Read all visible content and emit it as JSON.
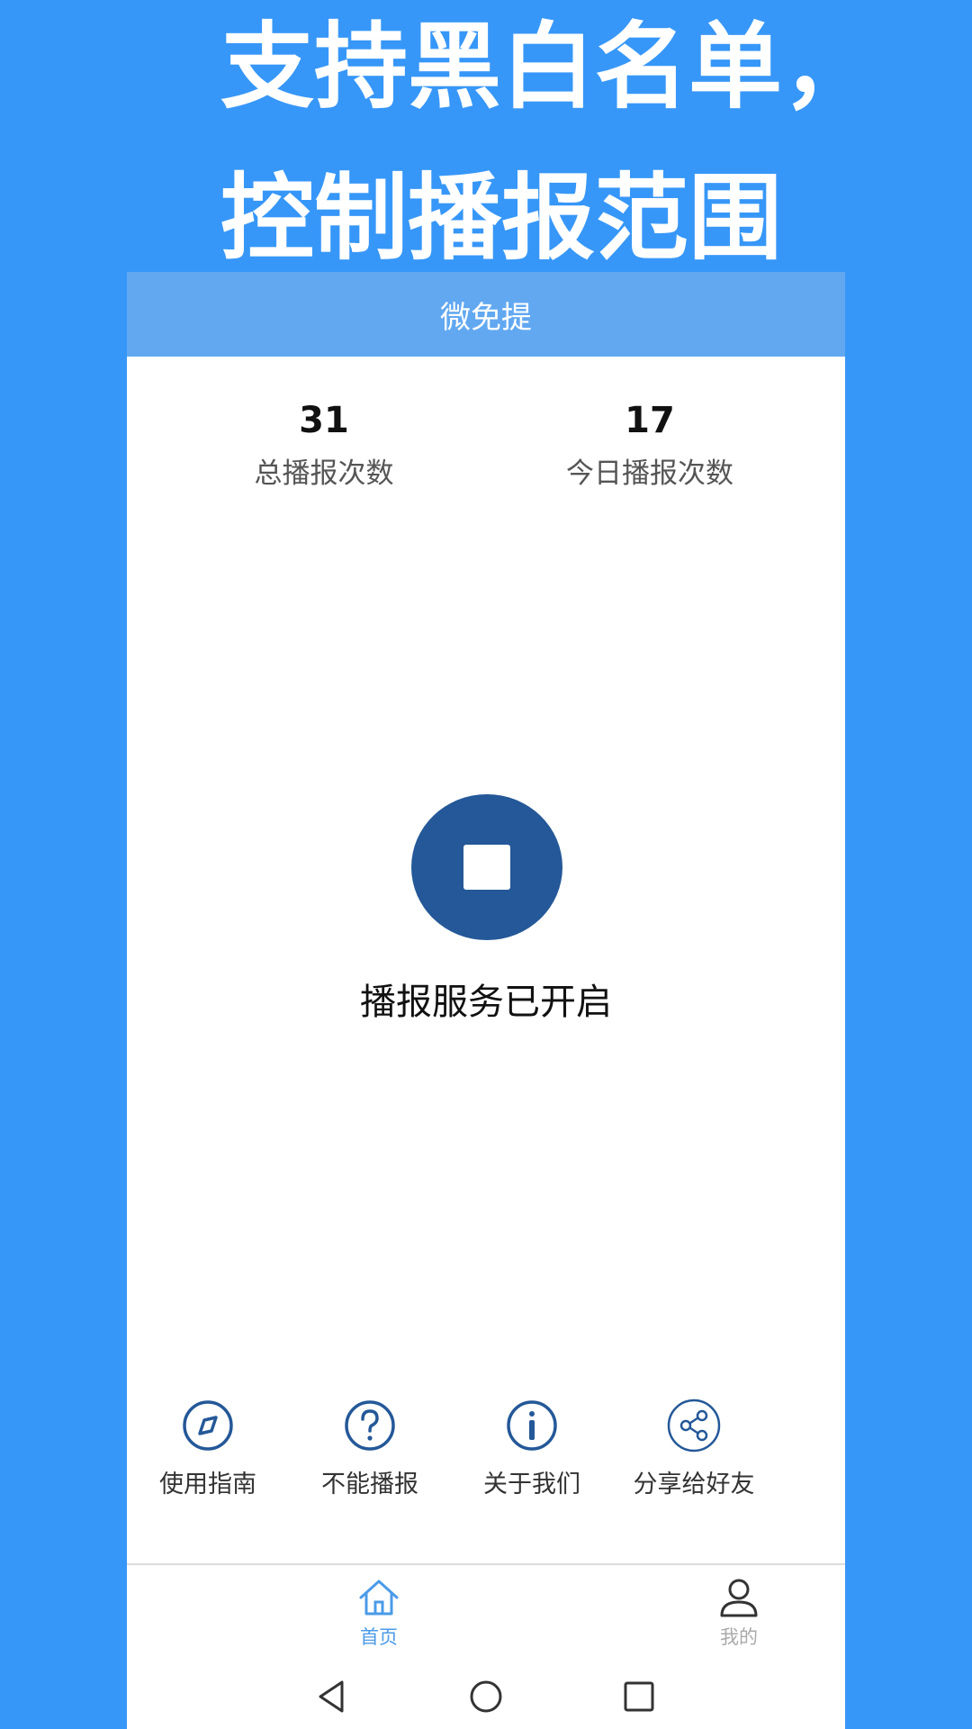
{
  "promo": {
    "line1": "支持黑白名单，",
    "line2": "控制播报范围"
  },
  "colors": {
    "background": "#3797f8",
    "appbar": "#62a8f1",
    "stop_button": "#245898",
    "active_tab": "#4b9be8"
  },
  "app": {
    "title": "微免提"
  },
  "stats": {
    "total": {
      "value": "31",
      "label": "总播报次数"
    },
    "today": {
      "value": "17",
      "label": "今日播报次数"
    }
  },
  "service": {
    "button_icon": "stop-icon",
    "status": "播报服务已开启"
  },
  "actions": [
    {
      "icon": "compass-icon",
      "label": "使用指南"
    },
    {
      "icon": "question-icon",
      "label": "不能播报"
    },
    {
      "icon": "info-icon",
      "label": "关于我们"
    },
    {
      "icon": "share-icon",
      "label": "分享给好友"
    }
  ],
  "tabs": [
    {
      "icon": "home-icon",
      "label": "首页",
      "active": true
    },
    {
      "icon": "user-icon",
      "label": "我的",
      "active": false
    }
  ],
  "navbar": {
    "buttons": [
      "back-icon",
      "home-circle-icon",
      "recents-icon"
    ]
  }
}
